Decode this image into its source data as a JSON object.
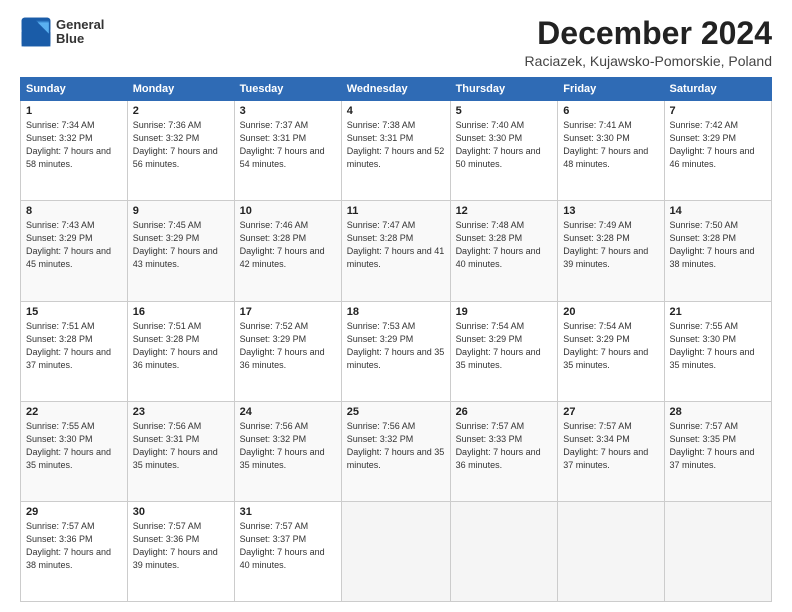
{
  "logo": {
    "line1": "General",
    "line2": "Blue"
  },
  "title": "December 2024",
  "subtitle": "Raciazek, Kujawsko-Pomorskie, Poland",
  "header_days": [
    "Sunday",
    "Monday",
    "Tuesday",
    "Wednesday",
    "Thursday",
    "Friday",
    "Saturday"
  ],
  "weeks": [
    [
      {
        "day": "1",
        "sunrise": "Sunrise: 7:34 AM",
        "sunset": "Sunset: 3:32 PM",
        "daylight": "Daylight: 7 hours and 58 minutes."
      },
      {
        "day": "2",
        "sunrise": "Sunrise: 7:36 AM",
        "sunset": "Sunset: 3:32 PM",
        "daylight": "Daylight: 7 hours and 56 minutes."
      },
      {
        "day": "3",
        "sunrise": "Sunrise: 7:37 AM",
        "sunset": "Sunset: 3:31 PM",
        "daylight": "Daylight: 7 hours and 54 minutes."
      },
      {
        "day": "4",
        "sunrise": "Sunrise: 7:38 AM",
        "sunset": "Sunset: 3:31 PM",
        "daylight": "Daylight: 7 hours and 52 minutes."
      },
      {
        "day": "5",
        "sunrise": "Sunrise: 7:40 AM",
        "sunset": "Sunset: 3:30 PM",
        "daylight": "Daylight: 7 hours and 50 minutes."
      },
      {
        "day": "6",
        "sunrise": "Sunrise: 7:41 AM",
        "sunset": "Sunset: 3:30 PM",
        "daylight": "Daylight: 7 hours and 48 minutes."
      },
      {
        "day": "7",
        "sunrise": "Sunrise: 7:42 AM",
        "sunset": "Sunset: 3:29 PM",
        "daylight": "Daylight: 7 hours and 46 minutes."
      }
    ],
    [
      {
        "day": "8",
        "sunrise": "Sunrise: 7:43 AM",
        "sunset": "Sunset: 3:29 PM",
        "daylight": "Daylight: 7 hours and 45 minutes."
      },
      {
        "day": "9",
        "sunrise": "Sunrise: 7:45 AM",
        "sunset": "Sunset: 3:29 PM",
        "daylight": "Daylight: 7 hours and 43 minutes."
      },
      {
        "day": "10",
        "sunrise": "Sunrise: 7:46 AM",
        "sunset": "Sunset: 3:28 PM",
        "daylight": "Daylight: 7 hours and 42 minutes."
      },
      {
        "day": "11",
        "sunrise": "Sunrise: 7:47 AM",
        "sunset": "Sunset: 3:28 PM",
        "daylight": "Daylight: 7 hours and 41 minutes."
      },
      {
        "day": "12",
        "sunrise": "Sunrise: 7:48 AM",
        "sunset": "Sunset: 3:28 PM",
        "daylight": "Daylight: 7 hours and 40 minutes."
      },
      {
        "day": "13",
        "sunrise": "Sunrise: 7:49 AM",
        "sunset": "Sunset: 3:28 PM",
        "daylight": "Daylight: 7 hours and 39 minutes."
      },
      {
        "day": "14",
        "sunrise": "Sunrise: 7:50 AM",
        "sunset": "Sunset: 3:28 PM",
        "daylight": "Daylight: 7 hours and 38 minutes."
      }
    ],
    [
      {
        "day": "15",
        "sunrise": "Sunrise: 7:51 AM",
        "sunset": "Sunset: 3:28 PM",
        "daylight": "Daylight: 7 hours and 37 minutes."
      },
      {
        "day": "16",
        "sunrise": "Sunrise: 7:51 AM",
        "sunset": "Sunset: 3:28 PM",
        "daylight": "Daylight: 7 hours and 36 minutes."
      },
      {
        "day": "17",
        "sunrise": "Sunrise: 7:52 AM",
        "sunset": "Sunset: 3:29 PM",
        "daylight": "Daylight: 7 hours and 36 minutes."
      },
      {
        "day": "18",
        "sunrise": "Sunrise: 7:53 AM",
        "sunset": "Sunset: 3:29 PM",
        "daylight": "Daylight: 7 hours and 35 minutes."
      },
      {
        "day": "19",
        "sunrise": "Sunrise: 7:54 AM",
        "sunset": "Sunset: 3:29 PM",
        "daylight": "Daylight: 7 hours and 35 minutes."
      },
      {
        "day": "20",
        "sunrise": "Sunrise: 7:54 AM",
        "sunset": "Sunset: 3:29 PM",
        "daylight": "Daylight: 7 hours and 35 minutes."
      },
      {
        "day": "21",
        "sunrise": "Sunrise: 7:55 AM",
        "sunset": "Sunset: 3:30 PM",
        "daylight": "Daylight: 7 hours and 35 minutes."
      }
    ],
    [
      {
        "day": "22",
        "sunrise": "Sunrise: 7:55 AM",
        "sunset": "Sunset: 3:30 PM",
        "daylight": "Daylight: 7 hours and 35 minutes."
      },
      {
        "day": "23",
        "sunrise": "Sunrise: 7:56 AM",
        "sunset": "Sunset: 3:31 PM",
        "daylight": "Daylight: 7 hours and 35 minutes."
      },
      {
        "day": "24",
        "sunrise": "Sunrise: 7:56 AM",
        "sunset": "Sunset: 3:32 PM",
        "daylight": "Daylight: 7 hours and 35 minutes."
      },
      {
        "day": "25",
        "sunrise": "Sunrise: 7:56 AM",
        "sunset": "Sunset: 3:32 PM",
        "daylight": "Daylight: 7 hours and 35 minutes."
      },
      {
        "day": "26",
        "sunrise": "Sunrise: 7:57 AM",
        "sunset": "Sunset: 3:33 PM",
        "daylight": "Daylight: 7 hours and 36 minutes."
      },
      {
        "day": "27",
        "sunrise": "Sunrise: 7:57 AM",
        "sunset": "Sunset: 3:34 PM",
        "daylight": "Daylight: 7 hours and 37 minutes."
      },
      {
        "day": "28",
        "sunrise": "Sunrise: 7:57 AM",
        "sunset": "Sunset: 3:35 PM",
        "daylight": "Daylight: 7 hours and 37 minutes."
      }
    ],
    [
      {
        "day": "29",
        "sunrise": "Sunrise: 7:57 AM",
        "sunset": "Sunset: 3:36 PM",
        "daylight": "Daylight: 7 hours and 38 minutes."
      },
      {
        "day": "30",
        "sunrise": "Sunrise: 7:57 AM",
        "sunset": "Sunset: 3:36 PM",
        "daylight": "Daylight: 7 hours and 39 minutes."
      },
      {
        "day": "31",
        "sunrise": "Sunrise: 7:57 AM",
        "sunset": "Sunset: 3:37 PM",
        "daylight": "Daylight: 7 hours and 40 minutes."
      },
      null,
      null,
      null,
      null
    ]
  ]
}
